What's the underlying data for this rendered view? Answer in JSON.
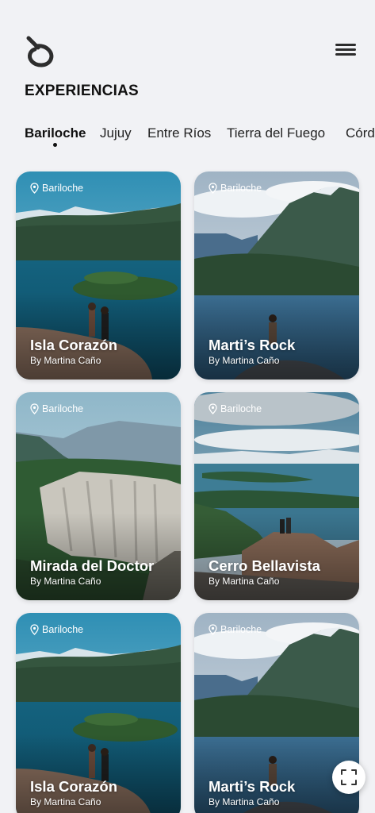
{
  "header": {
    "logo_icon": "brand-swirl-logo",
    "menu_icon": "hamburger-menu-icon",
    "title": "EXPERIENCIAS"
  },
  "tabs": [
    {
      "label": "Bariloche",
      "active": true
    },
    {
      "label": "Jujuy",
      "active": false
    },
    {
      "label": "Entre Ríos",
      "active": false
    },
    {
      "label": "Tierra del Fuego",
      "active": false
    },
    {
      "label": "Córd",
      "active": false
    }
  ],
  "cards": [
    {
      "location": "Bariloche",
      "title": "Isla Corazón",
      "author": "By Martina Caño",
      "scene": "island"
    },
    {
      "location": "Bariloche",
      "title": "Marti’s Rock",
      "author": "By Martina Caño",
      "scene": "rock"
    },
    {
      "location": "Bariloche",
      "title": "Mirada del Doctor",
      "author": "By Martina Caño",
      "scene": "cliff"
    },
    {
      "location": "Bariloche",
      "title": "Cerro Bellavista",
      "author": "By Martina Caño",
      "scene": "lakes"
    },
    {
      "location": "Bariloche",
      "title": "Isla Corazón",
      "author": "By Martina Caño",
      "scene": "island"
    },
    {
      "location": "Bariloche",
      "title": "Marti’s Rock",
      "author": "By Martina Caño",
      "scene": "rock"
    }
  ],
  "fab": {
    "icon": "fullscreen-expand-icon"
  },
  "colors": {
    "background": "#f1f2f5",
    "text": "#111111",
    "card_text": "#ffffff"
  }
}
